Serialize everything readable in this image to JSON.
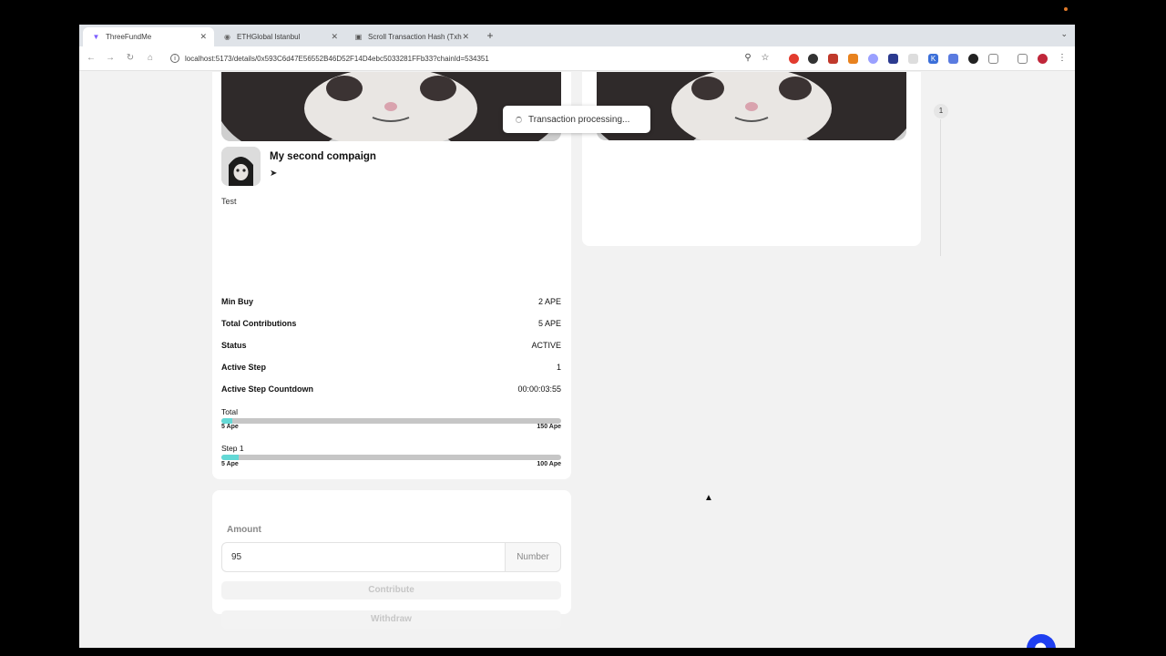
{
  "browser": {
    "tabs": [
      {
        "title": "ThreeFundMe",
        "active": true,
        "icon": "vite-logo-icon"
      },
      {
        "title": "ETHGlobal Istanbul",
        "active": false,
        "icon": "globe-icon"
      },
      {
        "title": "Scroll Transaction Hash (Txh",
        "active": false,
        "icon": "scroll-explorer-icon"
      }
    ],
    "new_tab": "+",
    "url": "localhost:5173/details/0x593C6d47E56552B46D52F14D4ebc5033281FFb33?chainId=534351"
  },
  "toast": {
    "text": "Transaction processing..."
  },
  "campaign": {
    "title": "My second compaign",
    "description": "Test",
    "stats": [
      {
        "label": "Min Buy",
        "value": "2 APE"
      },
      {
        "label": "Total Contributions",
        "value": "5 APE"
      },
      {
        "label": "Status",
        "value": "ACTIVE"
      },
      {
        "label": "Active Step",
        "value": "1"
      },
      {
        "label": "Active Step Countdown",
        "value": "00:00:03:55"
      }
    ],
    "progress": [
      {
        "label": "Total",
        "min": "5 Ape",
        "max": "150 Ape",
        "fraction": 0.033
      },
      {
        "label": "Step 1",
        "min": "5 Ape",
        "max": "100 Ape",
        "fraction": 0.05
      }
    ]
  },
  "form": {
    "amount_label": "Amount",
    "amount_value": "95",
    "amount_addon": "Number",
    "contribute_label": "Contribute",
    "withdraw_label": "Withdraw"
  },
  "steps": {
    "current": "1"
  },
  "colors": {
    "accent": "#63d9d6",
    "chat": "#1f3ff0"
  }
}
